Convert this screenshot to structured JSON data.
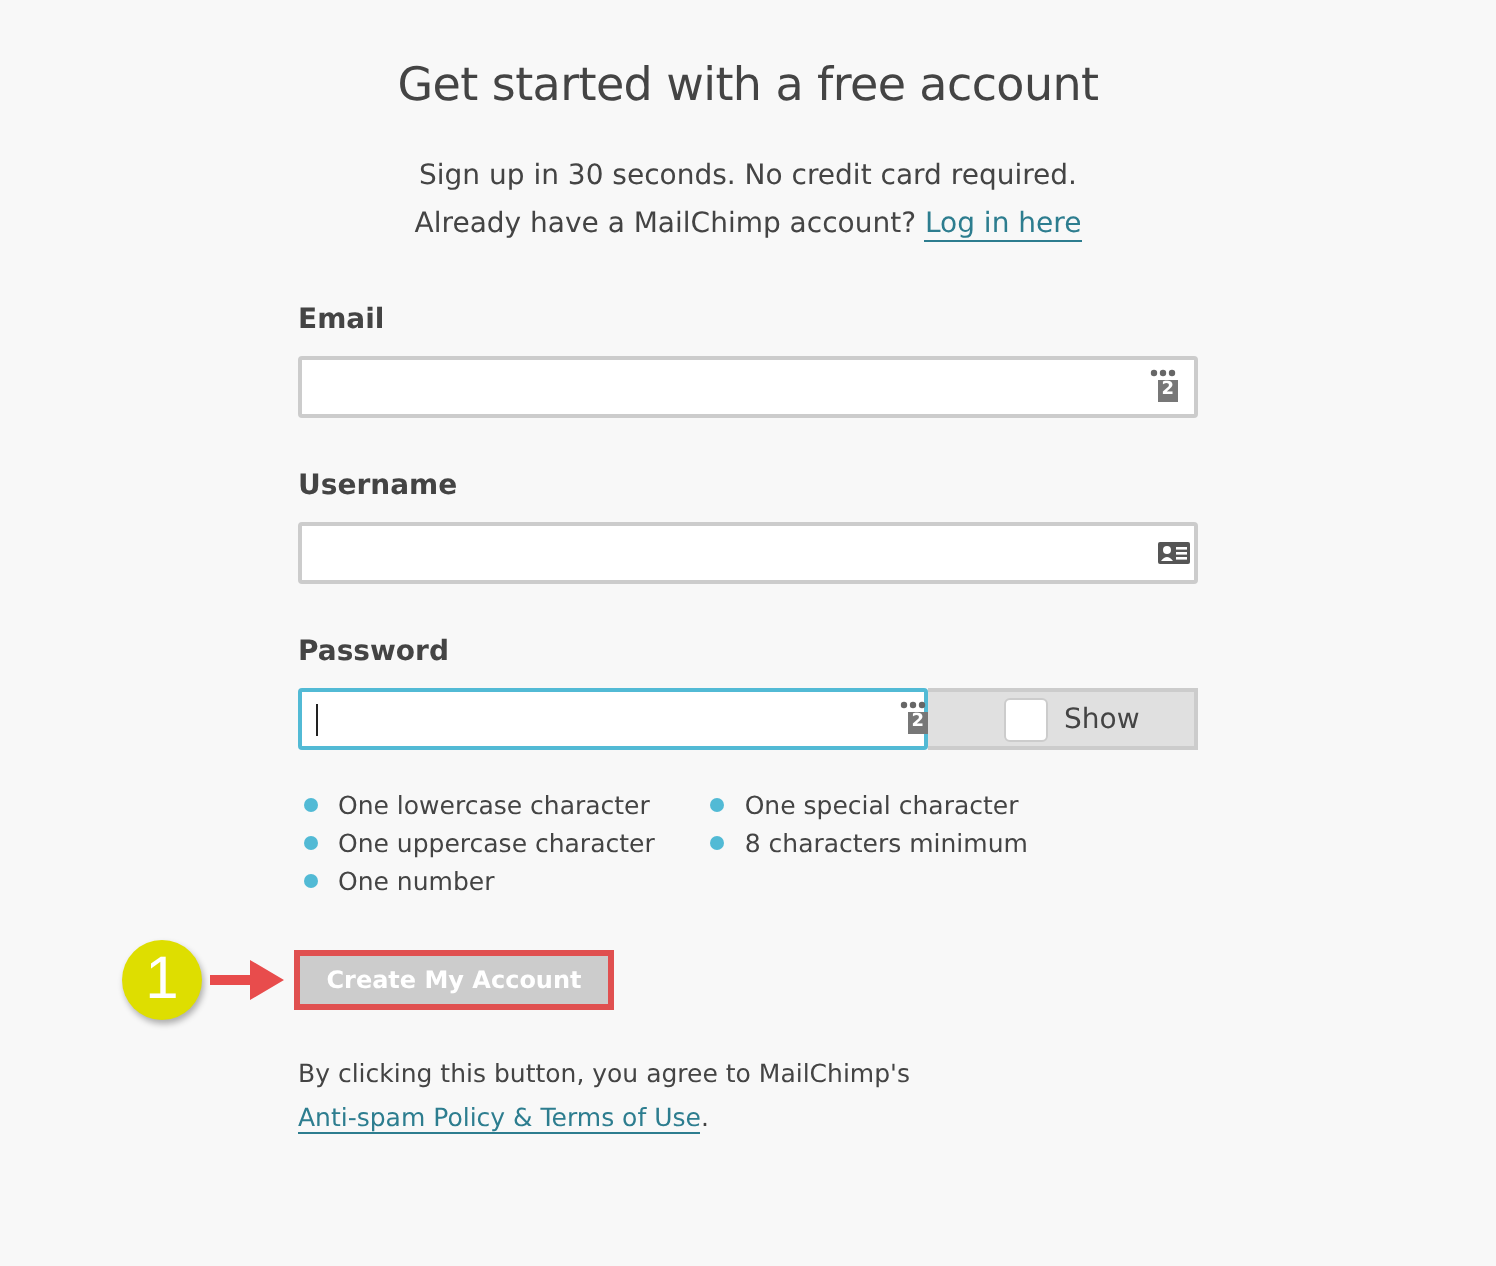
{
  "title": "Get started with a free account",
  "subtitle": "Sign up in 30 seconds. No credit card required.",
  "login_prompt": {
    "text": "Already have a MailChimp account?",
    "link": "Log in here"
  },
  "fields": [
    {
      "label": "Email",
      "kind": "manager",
      "badge": "2",
      "focused": false
    },
    {
      "label": "Username",
      "kind": "card",
      "focused": false
    },
    {
      "label": "Password",
      "kind": "password",
      "badge": "2",
      "focused": true,
      "show_toggle": {
        "label": "Show",
        "checked": false
      }
    }
  ],
  "requirements": [
    {
      "text": "One lowercase character"
    },
    {
      "text": "One uppercase character"
    },
    {
      "text": "One number"
    },
    {
      "text": "One special character"
    },
    {
      "text": "8 characters minimum"
    }
  ],
  "submit": {
    "label": "Create My Account",
    "disabled": true
  },
  "callout": {
    "number": "1"
  },
  "agreement": {
    "text": "By clicking this button, you agree to MailChimp's",
    "link": "Anti-spam Policy & Terms of Use",
    "end": "."
  }
}
